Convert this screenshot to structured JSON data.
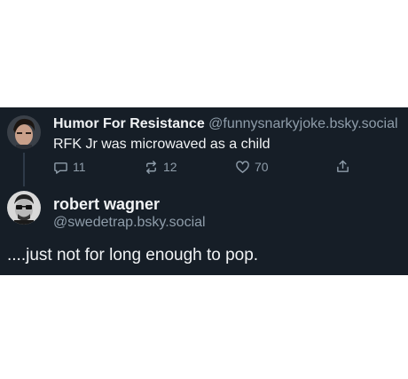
{
  "post": {
    "author_name": "Humor For Resistance",
    "author_handle": "@funnysnarkyjoke.bsky.social",
    "text": "RFK Jr was microwaved as a child",
    "actions": {
      "reply_count": "11",
      "repost_count": "12",
      "like_count": "70"
    }
  },
  "reply": {
    "author_name": "robert wagner",
    "author_handle": "@swedetrap.bsky.social",
    "text": "....just not for long enough to pop."
  },
  "colors": {
    "background": "#161e27",
    "text": "#f1f3f5",
    "muted": "#8f9daa"
  },
  "icons": [
    "reply-icon",
    "repost-icon",
    "like-icon",
    "share-icon"
  ]
}
